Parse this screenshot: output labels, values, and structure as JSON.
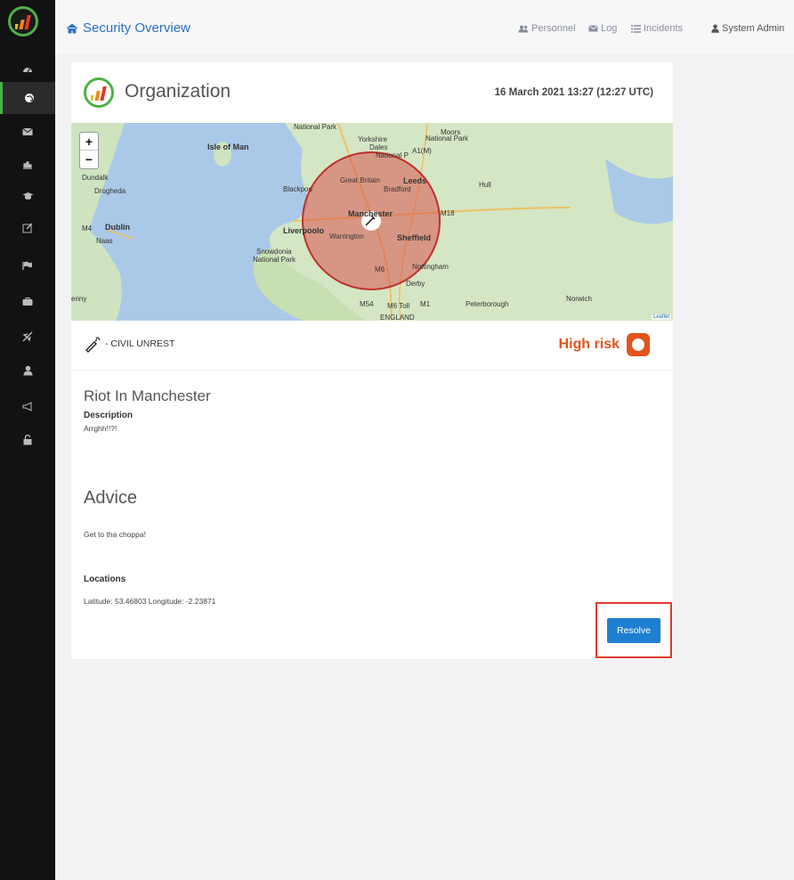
{
  "brand": {
    "title": "Security Overview",
    "icon": "home-icon"
  },
  "topnav": {
    "personnel": "Personnel",
    "log": "Log",
    "incidents": "Incidents",
    "user": "System Admin"
  },
  "sidebar": {
    "items": [
      {
        "icon": "dashboard-icon"
      },
      {
        "icon": "globe-icon",
        "active": true
      },
      {
        "icon": "envelope-icon"
      },
      {
        "icon": "chart-icon"
      },
      {
        "icon": "graduation-cap-icon"
      },
      {
        "icon": "edit-icon"
      },
      {
        "icon": "flag-icon"
      },
      {
        "icon": "briefcase-icon"
      },
      {
        "icon": "plane-icon"
      },
      {
        "icon": "user-icon"
      },
      {
        "icon": "bullhorn-icon"
      },
      {
        "icon": "unlock-icon"
      }
    ]
  },
  "card": {
    "org_title": "Organization",
    "date": "16 March 2021 13:27 (12:27 UTC)"
  },
  "map": {
    "zoom_in": "+",
    "zoom_out": "−",
    "attribution": "Leaflet",
    "labels": {
      "isle_of_man": "Isle of Man",
      "national_park": "National Park",
      "yorkshire": "Yorkshire",
      "dales": "Dales",
      "national_p": "National P",
      "moors": "Moors",
      "moors_np": "National Park",
      "a1m": "A1(M)",
      "dundalk": "Dundalk",
      "drogheda": "Drogheda",
      "blackpool": "Blackpoo",
      "great_britain": "Great Britain",
      "leeds": "Leeds",
      "bradford": "Bradford",
      "hull": "Hull",
      "m4": "M4",
      "dublin": "Dublin",
      "naas": "Naas",
      "manchester": "Manchester",
      "m18": "M18",
      "liverpool": "Liverpoolo",
      "warrington": "Warrington",
      "sheffield": "Sheffield",
      "snowdonia": "Snowdonia",
      "snowdonia_np": "National Park",
      "nottingham": "Nottingham",
      "m6": "M6",
      "derby": "Derby",
      "norwich": "Norwich",
      "m54": "M54",
      "m6toll": "M6 Toll",
      "m1": "M1",
      "peterborough": "Peterborough",
      "england": "ENGLAND",
      "enny": "enny"
    },
    "incident_radius_color": "#d9534f"
  },
  "incident": {
    "type": "- CIVIL UNREST",
    "risk_label": "High risk",
    "risk_color": "#e2541b",
    "title": "Riot In Manchester",
    "description_label": "Description",
    "description": "Arrghh!!?!",
    "advice_title": "Advice",
    "advice": "Get to tha choppa!",
    "locations_label": "Locations",
    "location": "Latitude: 53.46803 Longitude: -2.23871",
    "resolve_label": "Resolve"
  },
  "colors": {
    "accent_green": "#4fb04a",
    "link_blue": "#2a6fc2",
    "button_blue": "#1f7fd1",
    "highlight_red": "#e03a2a"
  }
}
